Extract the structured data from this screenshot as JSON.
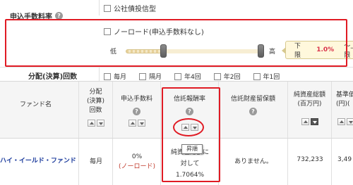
{
  "filters": {
    "bond_type_option": "公社債投信型",
    "fee": {
      "label": "申込手数料率",
      "noload_option": "ノーロード(申込手数料なし)",
      "slider_low_label": "低",
      "slider_high_label": "高",
      "tooltip_lower_label": "下限",
      "tooltip_lower_value": "1.0%",
      "tooltip_upper_label": "〜上限"
    },
    "distribution": {
      "label": "分配(決算)回数",
      "options": [
        "毎月",
        "隔月",
        "年4回",
        "年2回",
        "年1回"
      ]
    }
  },
  "table": {
    "headers": {
      "name": "ファンド名",
      "distribution": "分配\n(決算)\n回数",
      "fee": "申込手数料",
      "trust_fee": "信託報酬率",
      "reserve": "信託財産留保額",
      "net_assets": "純資産総額\n(百万円)",
      "base_price": "基準価\n(円)("
    },
    "row": {
      "name": "ハイ・イールド・ファンド",
      "distribution": "毎月",
      "fee_value": "0%",
      "fee_note": "(ノーロード)",
      "trust_fee_line1": "純資産総額に",
      "trust_fee_line2": "対して",
      "trust_fee_line3": "1.7064%",
      "reserve": "ありません。",
      "net_assets": "732,233",
      "base_price": "3,49"
    },
    "sort_tooltip": "昇順"
  },
  "colors": {
    "highlight": "#e01b24",
    "fund_link": "#1a3a9c",
    "percent": "#d9334a"
  }
}
